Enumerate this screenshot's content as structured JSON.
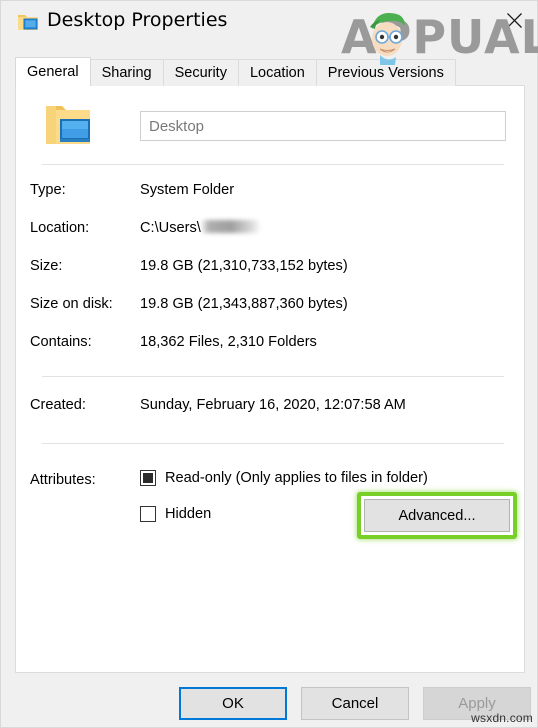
{
  "window": {
    "title": "Desktop Properties",
    "icon": "desktop-folder-icon",
    "close_label": "✕"
  },
  "tabs": [
    {
      "label": "General",
      "active": true
    },
    {
      "label": "Sharing",
      "active": false
    },
    {
      "label": "Security",
      "active": false
    },
    {
      "label": "Location",
      "active": false
    },
    {
      "label": "Previous Versions",
      "active": false
    }
  ],
  "general": {
    "name_value": "Desktop",
    "name_placeholder": "Desktop",
    "rows": [
      {
        "label": "Type:",
        "value": "System Folder"
      },
      {
        "label": "Location:",
        "value": "C:\\Users\\",
        "redacted": true
      },
      {
        "label": "Size:",
        "value": "19.8 GB (21,310,733,152 bytes)"
      },
      {
        "label": "Size on disk:",
        "value": "19.8 GB (21,343,887,360 bytes)"
      },
      {
        "label": "Contains:",
        "value": "18,362 Files, 2,310 Folders"
      },
      {
        "label": "Created:",
        "value": "Sunday, February 16, 2020, 12:07:58 AM"
      }
    ],
    "attributes_label": "Attributes:",
    "readonly_label": "Read-only (Only applies to files in folder)",
    "readonly_state": "indeterminate",
    "hidden_label": "Hidden",
    "hidden_state": "unchecked",
    "advanced_label": "Advanced..."
  },
  "footer": {
    "ok_label": "OK",
    "cancel_label": "Cancel",
    "apply_label": "Apply",
    "apply_disabled": true
  },
  "watermarks": {
    "brand": "APPUALS",
    "bottom": "wsxdn.com"
  },
  "colors": {
    "highlight_green": "#78cf28",
    "focus_blue": "#0078d7",
    "dialog_bg": "#f0f0f0",
    "panel_bg": "#ffffff",
    "folder_yellow": "#fbd978",
    "screen_blue": "#2a8fe0"
  }
}
